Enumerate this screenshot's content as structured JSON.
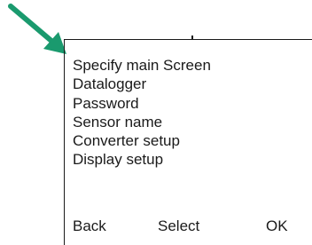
{
  "pointer": {
    "icon": "arrow-pointer-icon",
    "color": "#1a9a6e"
  },
  "menu": {
    "items": [
      {
        "label": "Specify main Screen"
      },
      {
        "label": "Datalogger"
      },
      {
        "label": "Password"
      },
      {
        "label": "Sensor name"
      },
      {
        "label": "Converter setup"
      },
      {
        "label": "Display setup"
      }
    ]
  },
  "softkeys": {
    "back": "Back",
    "select": "Select",
    "ok": "OK"
  }
}
